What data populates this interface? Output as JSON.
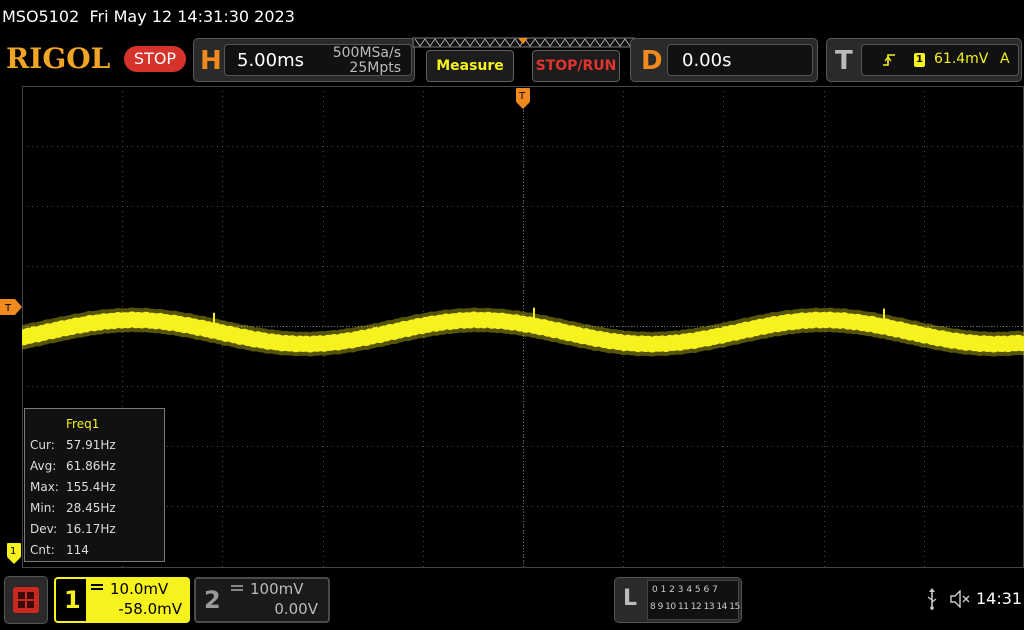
{
  "header": {
    "model": "MSO5102",
    "datetime": "Fri May 12 14:31:30 2023"
  },
  "topbar": {
    "logo": "RIGOL",
    "run_state": "STOP",
    "horizontal_letter": "H",
    "timebase": "5.00ms",
    "sample_rate": "500MSa/s",
    "memory_depth": "25Mpts",
    "measure_label": "Measure",
    "stoprun_label": "STOP/RUN",
    "delay_letter": "D",
    "delay_value": "0.00s",
    "trigger_letter": "T",
    "trigger_source": "1",
    "trigger_level": "61.4mV",
    "trigger_mode": "A"
  },
  "markers": {
    "trigger_left": "T",
    "trigger_top": "T",
    "channel1": "1"
  },
  "measurement": {
    "title": "Freq1",
    "rows": [
      {
        "label": "Cur:",
        "value": "57.91Hz"
      },
      {
        "label": "Avg:",
        "value": "61.86Hz"
      },
      {
        "label": "Max:",
        "value": "155.4Hz"
      },
      {
        "label": "Min:",
        "value": "28.45Hz"
      },
      {
        "label": "Dev:",
        "value": "16.17Hz"
      },
      {
        "label": "Cnt:",
        "value": "114"
      }
    ]
  },
  "bottombar": {
    "ch1": {
      "number": "1",
      "scale": "10.0mV",
      "offset": "-58.0mV"
    },
    "ch2": {
      "number": "2",
      "scale": "100mV",
      "offset": "0.00V"
    },
    "logic": {
      "letter": "L",
      "row1": "0 1 2 3  4 5 6 7",
      "row2": "8 9 10 11 12 13 14 15"
    },
    "clock": "14:31"
  },
  "colors": {
    "ch1": "#f5f21d",
    "accent": "#f08a1e",
    "stop": "#d6332c"
  }
}
